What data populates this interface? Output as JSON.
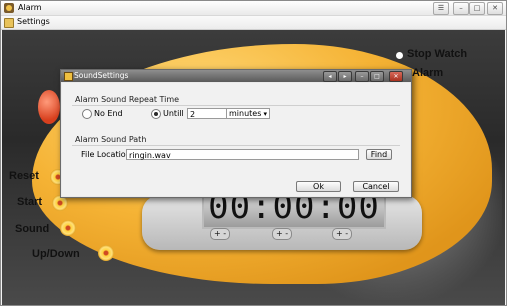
{
  "window": {
    "title": "Alarm",
    "controls": {
      "menu_glyph": "☰",
      "minimize": "–",
      "maximize": "□",
      "close": "✕"
    }
  },
  "menu": {
    "items": [
      {
        "label": "Settings"
      }
    ]
  },
  "scene": {
    "clock_display": "00:00:00",
    "left_labels": [
      "Reset",
      "Start",
      "Sound",
      "Up/Down"
    ],
    "right_labels": [
      "Stop Watch",
      "Alarm"
    ],
    "plus_minus": "+ -",
    "icons": {
      "flower": "flower-button-icon"
    }
  },
  "dialog": {
    "title": "SoundSettings",
    "controls": {
      "back": "◂",
      "fwd": "▸",
      "minimize": "–",
      "maximize": "□",
      "close": "✕"
    },
    "repeat_group": {
      "title": "Alarm Sound Repeat Time",
      "option_no_end": "No End",
      "option_until": "Untill",
      "selected": "Untill",
      "value": "2",
      "unit_selected": "minutes"
    },
    "path_group": {
      "title": "Alarm Sound Path",
      "location_label": "File Location",
      "location_value": "ringin.wav",
      "find_label": "Find"
    },
    "ok_label": "Ok",
    "cancel_label": "Cancel"
  },
  "colors": {
    "dialog_title": "#6e6e6e",
    "blob": "#f5b335",
    "accent_red": "#d8401e"
  }
}
